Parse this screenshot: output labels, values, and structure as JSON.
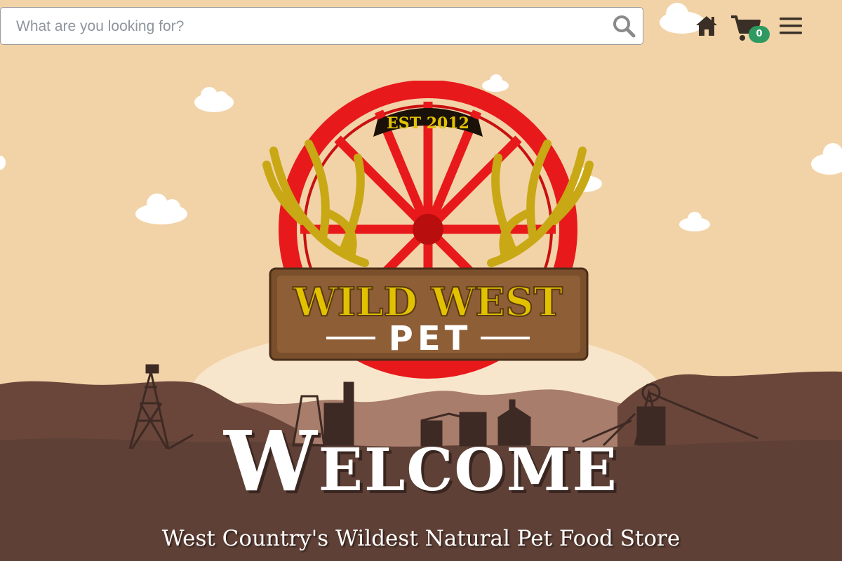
{
  "search": {
    "placeholder": "What are you looking for?",
    "value": "",
    "button_icon": "search-icon"
  },
  "nav": {
    "home_icon": "home-icon",
    "cart_icon": "cart-icon",
    "cart_count": "0",
    "menu_icon": "hamburger-menu-icon"
  },
  "logo": {
    "established": "EST 2012",
    "name": "WILD WEST",
    "subname": "PET"
  },
  "hero": {
    "heading": "Welcome",
    "tagline": "West Country's Wildest Natural Pet Food Store"
  },
  "colors": {
    "sky": "#f2d3a8",
    "ground": "#5e4036",
    "wheel_red": "#e8191b",
    "badge_green": "#2e9a62",
    "antler_gold": "#c8a815"
  }
}
